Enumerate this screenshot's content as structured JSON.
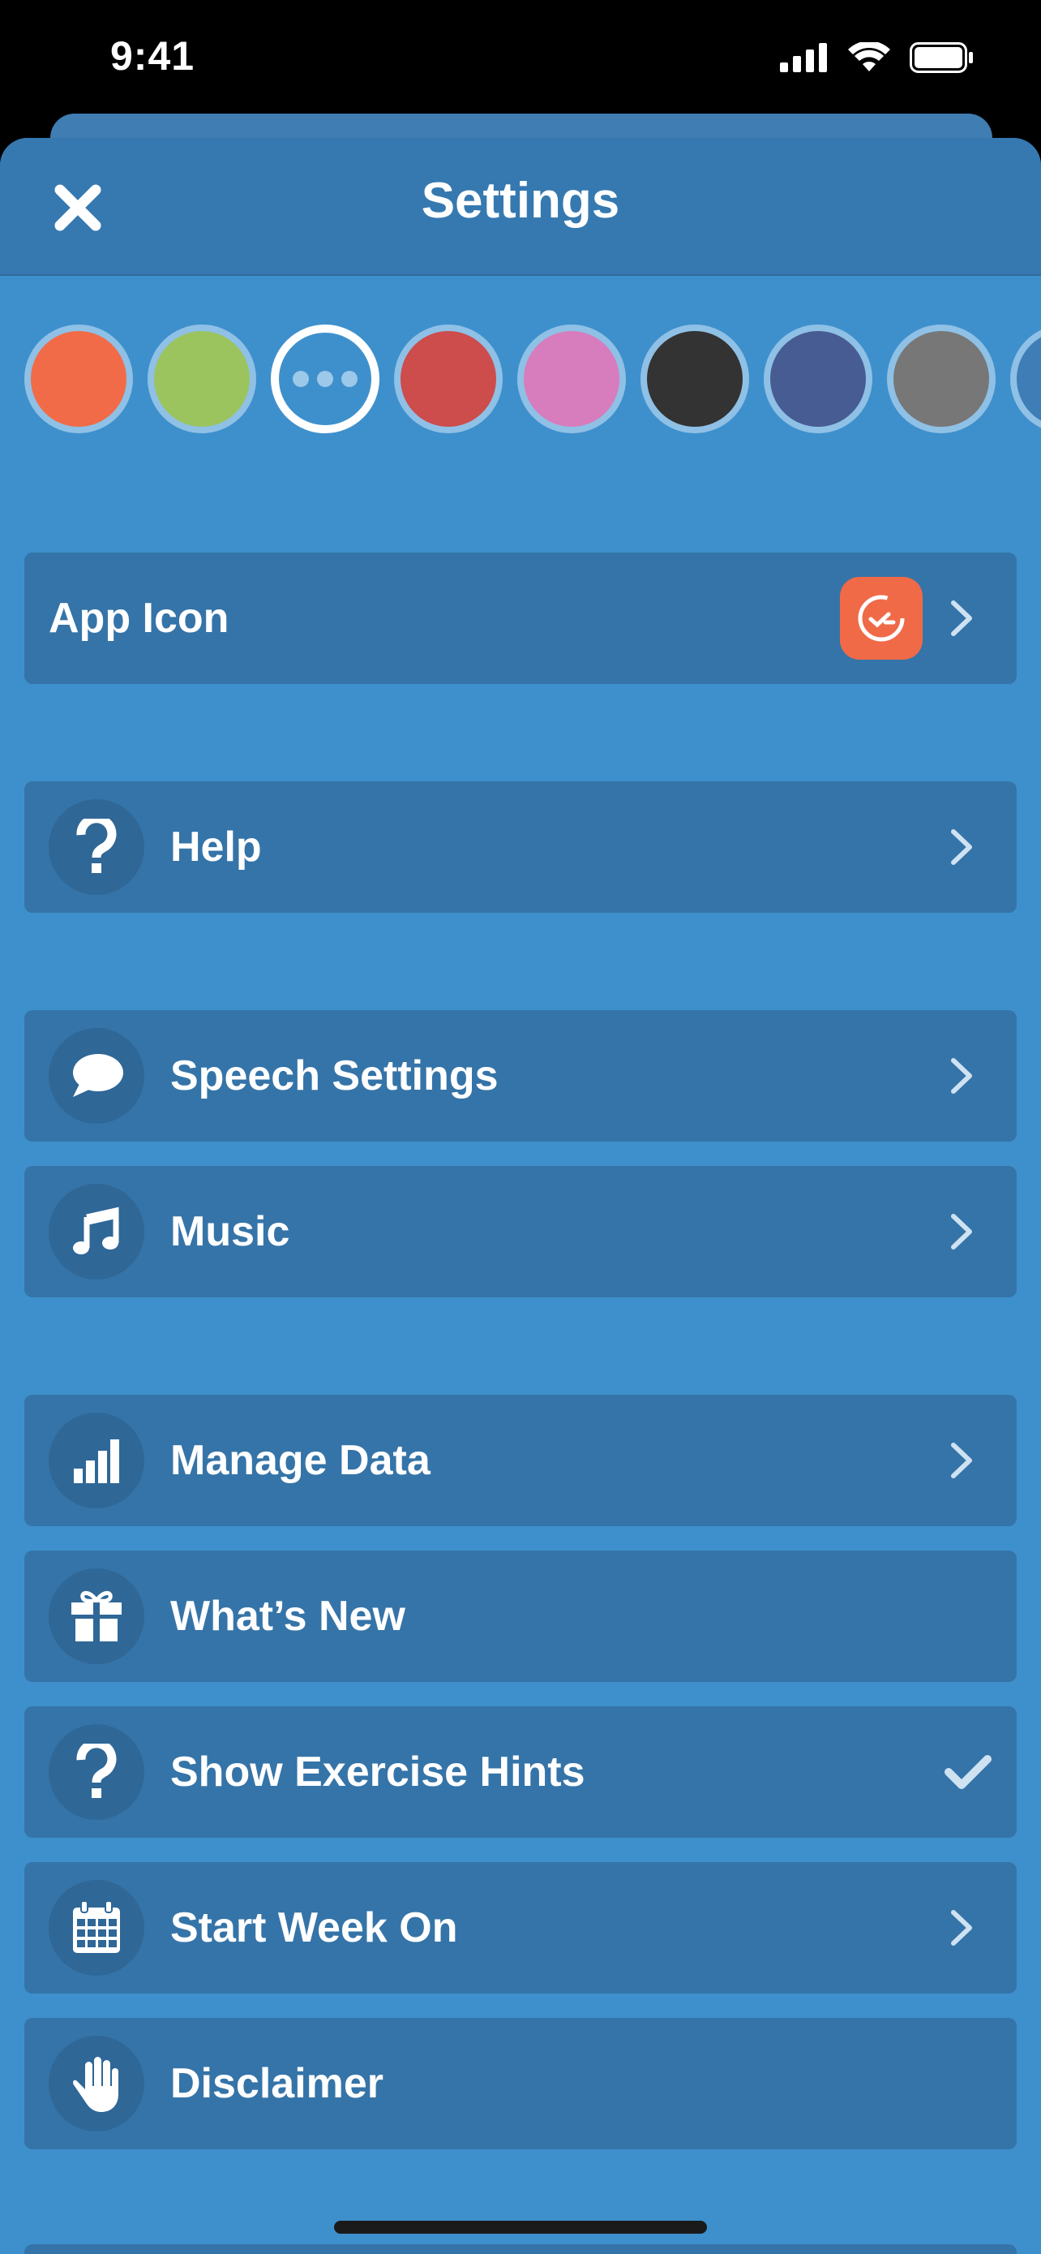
{
  "status_bar": {
    "time": "9:41"
  },
  "header": {
    "title": "Settings"
  },
  "swatches": [
    {
      "name": "orange",
      "color": "#f26b48"
    },
    {
      "name": "green",
      "color": "#9bc45f"
    },
    {
      "name": "more",
      "color": "#3e90cc",
      "selected": true
    },
    {
      "name": "red",
      "color": "#cd4c4c"
    },
    {
      "name": "pink",
      "color": "#d77cbc"
    },
    {
      "name": "black",
      "color": "#333333"
    },
    {
      "name": "navy",
      "color": "#475c92"
    },
    {
      "name": "gray",
      "color": "#777777"
    },
    {
      "name": "blue",
      "color": "#3e7db5"
    }
  ],
  "rows": {
    "app_icon": {
      "label": "App Icon"
    },
    "help": {
      "label": "Help"
    },
    "speech_settings": {
      "label": "Speech Settings"
    },
    "music": {
      "label": "Music"
    },
    "manage_data": {
      "label": "Manage Data"
    },
    "whats_new": {
      "label": "What’s New"
    },
    "show_exercise_hints": {
      "label": "Show Exercise Hints",
      "checked": true
    },
    "start_week_on": {
      "label": "Start Week On"
    },
    "disclaimer": {
      "label": "Disclaimer"
    }
  },
  "colors": {
    "background": "#3e90cc",
    "row": "#3574a8",
    "nav": "#3679b0",
    "accent": "#f06a48"
  }
}
